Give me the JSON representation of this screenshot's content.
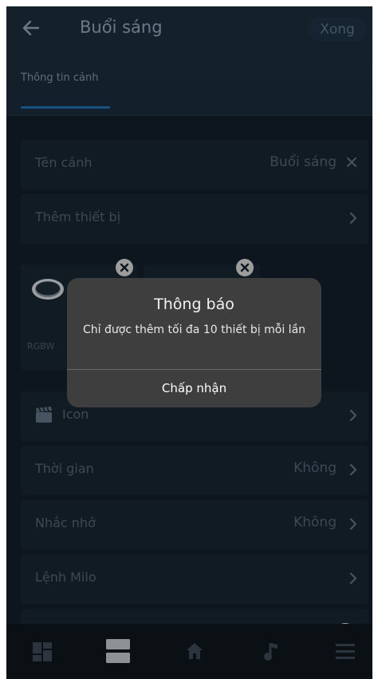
{
  "header": {
    "title": "Buổi sáng",
    "done_label": "Xong",
    "tab_label": "Thông tin cảnh"
  },
  "rows": {
    "scene_name": {
      "label": "Tên cảnh",
      "value": "Buổi sáng"
    },
    "add_device": {
      "label": "Thêm thiết bị"
    },
    "icon": {
      "label": "Icon"
    },
    "time": {
      "label": "Thời gian",
      "value": "Không"
    },
    "reminder": {
      "label": "Nhắc nhở",
      "value": "Không"
    },
    "milo": {
      "label": "Lệnh Milo"
    }
  },
  "devices": [
    {
      "name": "RGBW"
    },
    {
      "name": ""
    }
  ],
  "dialog": {
    "title": "Thông báo",
    "message": "Chỉ được thêm tối đa 10 thiết bị mỗi lần",
    "button_label": "Chấp nhận"
  },
  "colors": {
    "background": "#121e29",
    "row": "#17242f",
    "accent": "#1f6dac",
    "dialog": "#3e3e3e"
  },
  "nav_icons": [
    "dashboard-icon",
    "scenes-icon",
    "home-icon",
    "music-icon",
    "menu-icon"
  ]
}
